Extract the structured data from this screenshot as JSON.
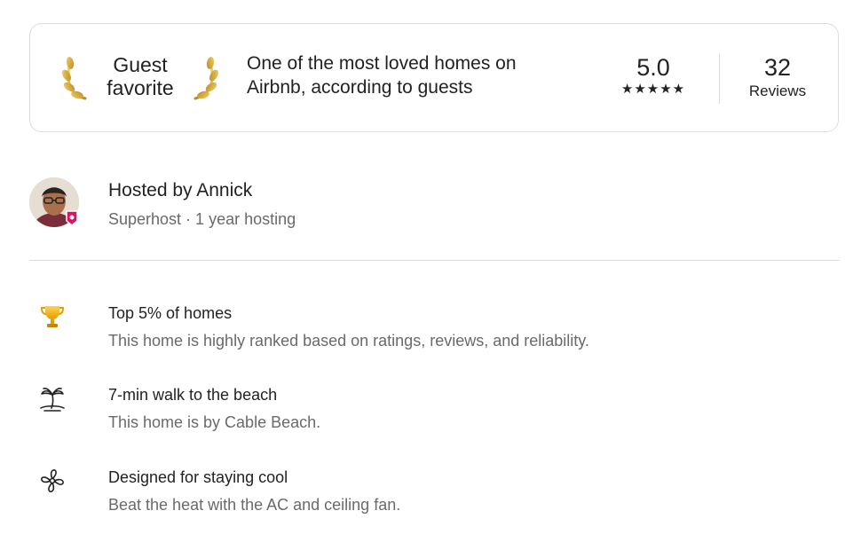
{
  "guest_favorite": {
    "badge_line1": "Guest",
    "badge_line2": "favorite",
    "tagline": "One of the most loved homes on Airbnb, according to guests",
    "rating": "5.0",
    "stars": "★★★★★",
    "stars_value": 5,
    "reviews_count": "32",
    "reviews_label": "Reviews"
  },
  "host": {
    "name": "Hosted by Annick",
    "subtitle": "Superhost · 1 year hosting",
    "badge_color": "#e0115f"
  },
  "features": [
    {
      "icon": "trophy-icon",
      "title": "Top 5% of homes",
      "description": "This home is highly ranked based on ratings, reviews, and reliability."
    },
    {
      "icon": "palm-tree-beach-icon",
      "title": "7-min walk to the beach",
      "description": "This home is by Cable Beach."
    },
    {
      "icon": "fan-icon",
      "title": "Designed for staying cool",
      "description": "Beat the heat with the AC and ceiling fan."
    }
  ],
  "colors": {
    "text_primary": "#222222",
    "text_secondary": "#6a6a6a",
    "border": "#dddddd",
    "laurel_gold": "#d4a437",
    "trophy_gold": "#f4b400"
  }
}
